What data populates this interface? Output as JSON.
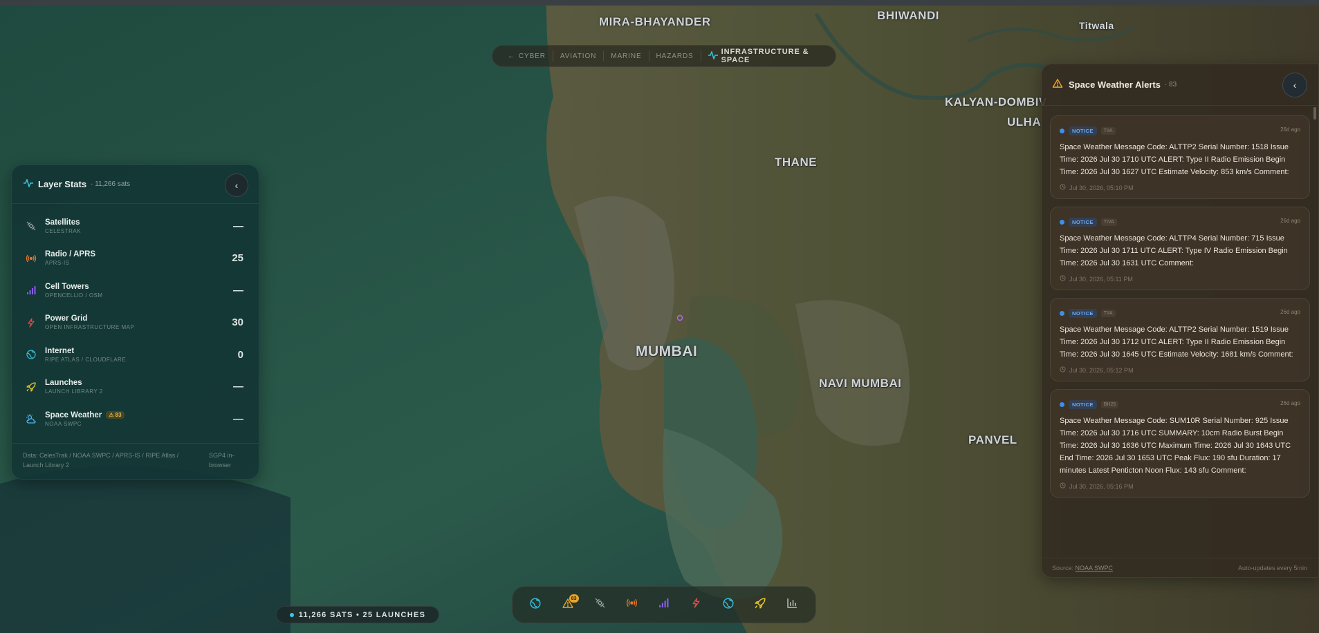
{
  "map": {
    "cities": [
      "MIRA-BHAYANDER",
      "BHIWANDI",
      "Titwala",
      "KALYAN-DOMBIV",
      "ULHA",
      "THANE",
      "MUMBAI",
      "NAVI MUMBAI",
      "PANVEL"
    ]
  },
  "category_bar": {
    "items": [
      {
        "label": "CYBER",
        "active": false,
        "icon": "arrow-left-icon"
      },
      {
        "label": "AVIATION",
        "active": false
      },
      {
        "label": "MARINE",
        "active": false
      },
      {
        "label": "HAZARDS",
        "active": false
      },
      {
        "label": "INFRASTRUCTURE & SPACE",
        "active": true,
        "icon": "activity-icon"
      }
    ]
  },
  "layer_stats": {
    "title": "Layer Stats",
    "subtitle": "· 11,266 sats",
    "collapse_label": "‹",
    "layers": [
      {
        "name": "Satellites",
        "source": "CELESTRAK",
        "value": "—",
        "icon": "satellite-icon",
        "color": "#9aa6a4"
      },
      {
        "name": "Radio / APRS",
        "source": "APRS-IS",
        "value": "25",
        "icon": "radio-icon",
        "color": "#e8742a"
      },
      {
        "name": "Cell Towers",
        "source": "OPENCELLID / OSM",
        "value": "—",
        "icon": "signal-bars-icon",
        "color": "#8a5cf0"
      },
      {
        "name": "Power Grid",
        "source": "OPEN INFRASTRUCTURE MAP",
        "value": "30",
        "icon": "lightning-icon",
        "color": "#e84848"
      },
      {
        "name": "Internet",
        "source": "RIPE ATLAS / CLOUDFLARE",
        "value": "0",
        "icon": "globe-icon",
        "color": "#36c2e0"
      },
      {
        "name": "Launches",
        "source": "LAUNCH LIBRARY 2",
        "value": "—",
        "icon": "rocket-icon",
        "color": "#e8c42a"
      },
      {
        "name": "Space Weather",
        "source": "NOAA SWPC",
        "value": "—",
        "icon": "sun-cloud-icon",
        "color": "#4fb6ee",
        "badge": "⚠ 83"
      }
    ],
    "footer_left": "Data: CelesTrak / NOAA SWPC / APRS-IS / RIPE Atlas / Launch Library 2",
    "footer_right": "SGP4 in-browser"
  },
  "status_pill": {
    "text": "11,266 SATS • 25 LAUNCHES",
    "dot_color": "#3cc7e4"
  },
  "toolbar": {
    "buttons": [
      {
        "icon": "globe-icon",
        "color": "#36c2e0"
      },
      {
        "icon": "alert-triangle-icon",
        "color": "#e8a629",
        "badge": "83"
      },
      {
        "icon": "satellite-icon",
        "color": "#9aa6a4"
      },
      {
        "icon": "radio-icon",
        "color": "#e8742a"
      },
      {
        "icon": "signal-bars-icon",
        "color": "#8a5cf0"
      },
      {
        "icon": "lightning-icon",
        "color": "#e84848"
      },
      {
        "icon": "globe-icon",
        "color": "#36c2e0"
      },
      {
        "icon": "rocket-icon",
        "color": "#e8c42a"
      },
      {
        "icon": "bar-chart-icon",
        "color": "#c9cfcc"
      }
    ]
  },
  "alerts": {
    "title": "Space Weather Alerts",
    "count": "· 83",
    "close_label": "‹",
    "items": [
      {
        "kind": "NOTICE",
        "code": "TIIA",
        "age": "26d ago",
        "message": "Space Weather Message Code: ALTTP2 Serial Number: 1518 Issue Time: 2026 Jul 30 1710 UTC ALERT: Type II Radio Emission Begin Time: 2026 Jul 30 1627 UTC Estimate Velocity: 853 km/s Comment:",
        "time": "Jul 30, 2026, 05:10 PM"
      },
      {
        "kind": "NOTICE",
        "code": "TIVA",
        "age": "26d ago",
        "message": "Space Weather Message Code: ALTTP4 Serial Number: 715 Issue Time: 2026 Jul 30 1711 UTC ALERT: Type IV Radio Emission Begin Time: 2026 Jul 30 1631 UTC Comment:",
        "time": "Jul 30, 2026, 05:11 PM"
      },
      {
        "kind": "NOTICE",
        "code": "TIIA",
        "age": "26d ago",
        "message": "Space Weather Message Code: ALTTP2 Serial Number: 1519 Issue Time: 2026 Jul 30 1712 UTC ALERT: Type II Radio Emission Begin Time: 2026 Jul 30 1645 UTC Estimate Velocity: 1681 km/s Comment:",
        "time": "Jul 30, 2026, 05:12 PM"
      },
      {
        "kind": "NOTICE",
        "code": "BH25",
        "age": "26d ago",
        "message": "Space Weather Message Code: SUM10R Serial Number: 925 Issue Time: 2026 Jul 30 1716 UTC SUMMARY: 10cm Radio Burst Begin Time: 2026 Jul 30 1636 UTC Maximum Time: 2026 Jul 30 1643 UTC End Time: 2026 Jul 30 1653 UTC Peak Flux: 190 sfu Duration: 17 minutes Latest Penticton Noon Flux: 143 sfu Comment:",
        "time": "Jul 30, 2026, 05:16 PM"
      }
    ],
    "footer_source_prefix": "Source: ",
    "footer_source_link": "NOAA SWPC",
    "footer_right": "Auto-updates every 5min"
  }
}
